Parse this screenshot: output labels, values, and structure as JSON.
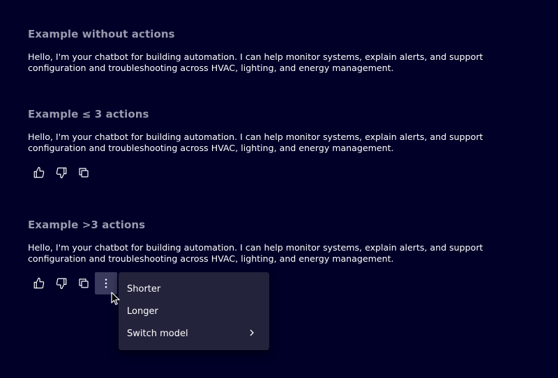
{
  "sections": [
    {
      "title": "Example without actions",
      "message": "Hello, I'm your chatbot for building automation. I can help monitor systems, explain alerts, and support configuration and troubleshooting across HVAC, lighting, and energy management."
    },
    {
      "title": "Example ≤ 3 actions",
      "message": "Hello, I'm your chatbot for building automation. I can help monitor systems, explain alerts, and support configuration and troubleshooting across HVAC, lighting, and energy management.",
      "actions": [
        "thumbs-up-icon",
        "thumbs-down-icon",
        "copy-icon"
      ]
    },
    {
      "title": "Example >3 actions",
      "message": "Hello, I'm your chatbot for building automation. I can help monitor systems, explain alerts, and support configuration and troubleshooting across HVAC, lighting, and energy management.",
      "actions": [
        "thumbs-up-icon",
        "thumbs-down-icon",
        "copy-icon",
        "more-vertical-icon"
      ]
    }
  ],
  "menu": {
    "items": [
      {
        "label": "Shorter"
      },
      {
        "label": "Longer"
      },
      {
        "label": "Switch model",
        "submenu": true
      }
    ]
  },
  "colors": {
    "background": "#000028",
    "title": "#9a9aae",
    "text": "#ffffff",
    "menu_bg": "#23233c",
    "active_button": "#3a3a5e"
  }
}
